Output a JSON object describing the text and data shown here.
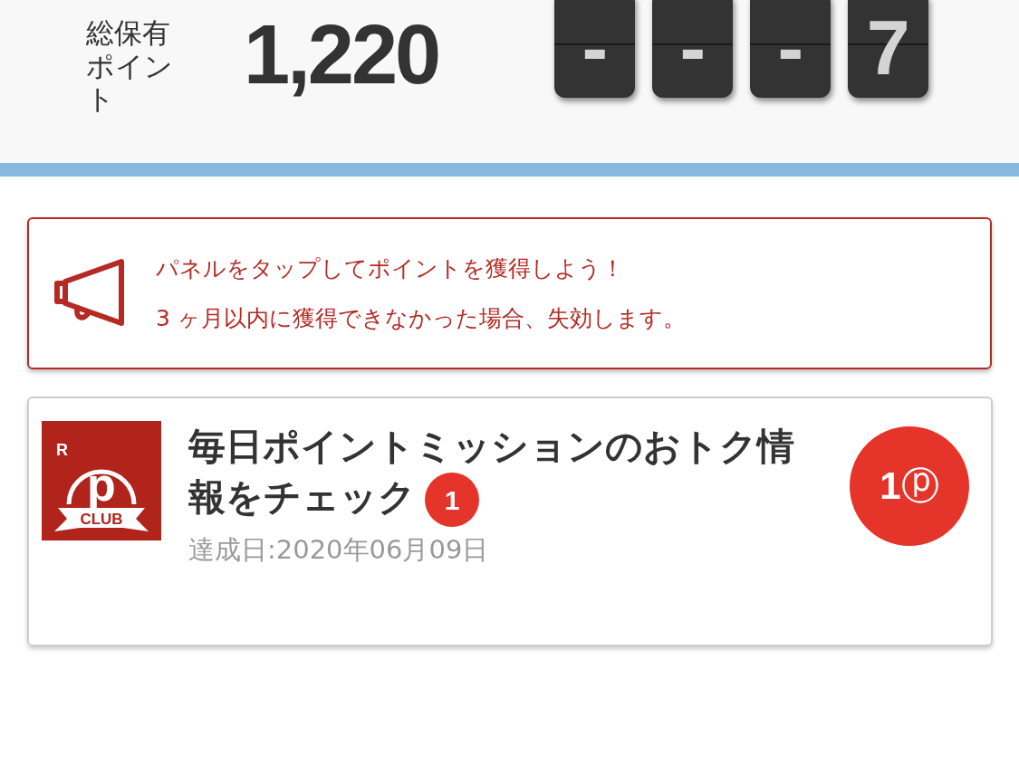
{
  "summary": {
    "label": "総保有ポイント",
    "points": "1,220",
    "counter": [
      "-",
      "-",
      "-",
      "7"
    ]
  },
  "notice": {
    "lines": [
      "パネルをタップしてポイントを獲得しよう！",
      "3 ヶ月以内に獲得できなかった場合、失効します。"
    ]
  },
  "missions": [
    {
      "logo": {
        "mark": "R",
        "letter": "p",
        "ribbon": "CLUB"
      },
      "title": "毎日ポイントミッションのおトク情報をチェック",
      "badge": "1",
      "date": "達成日:2020年06月09日",
      "reward": "1",
      "reward_unit": "ⓟ"
    }
  ]
}
